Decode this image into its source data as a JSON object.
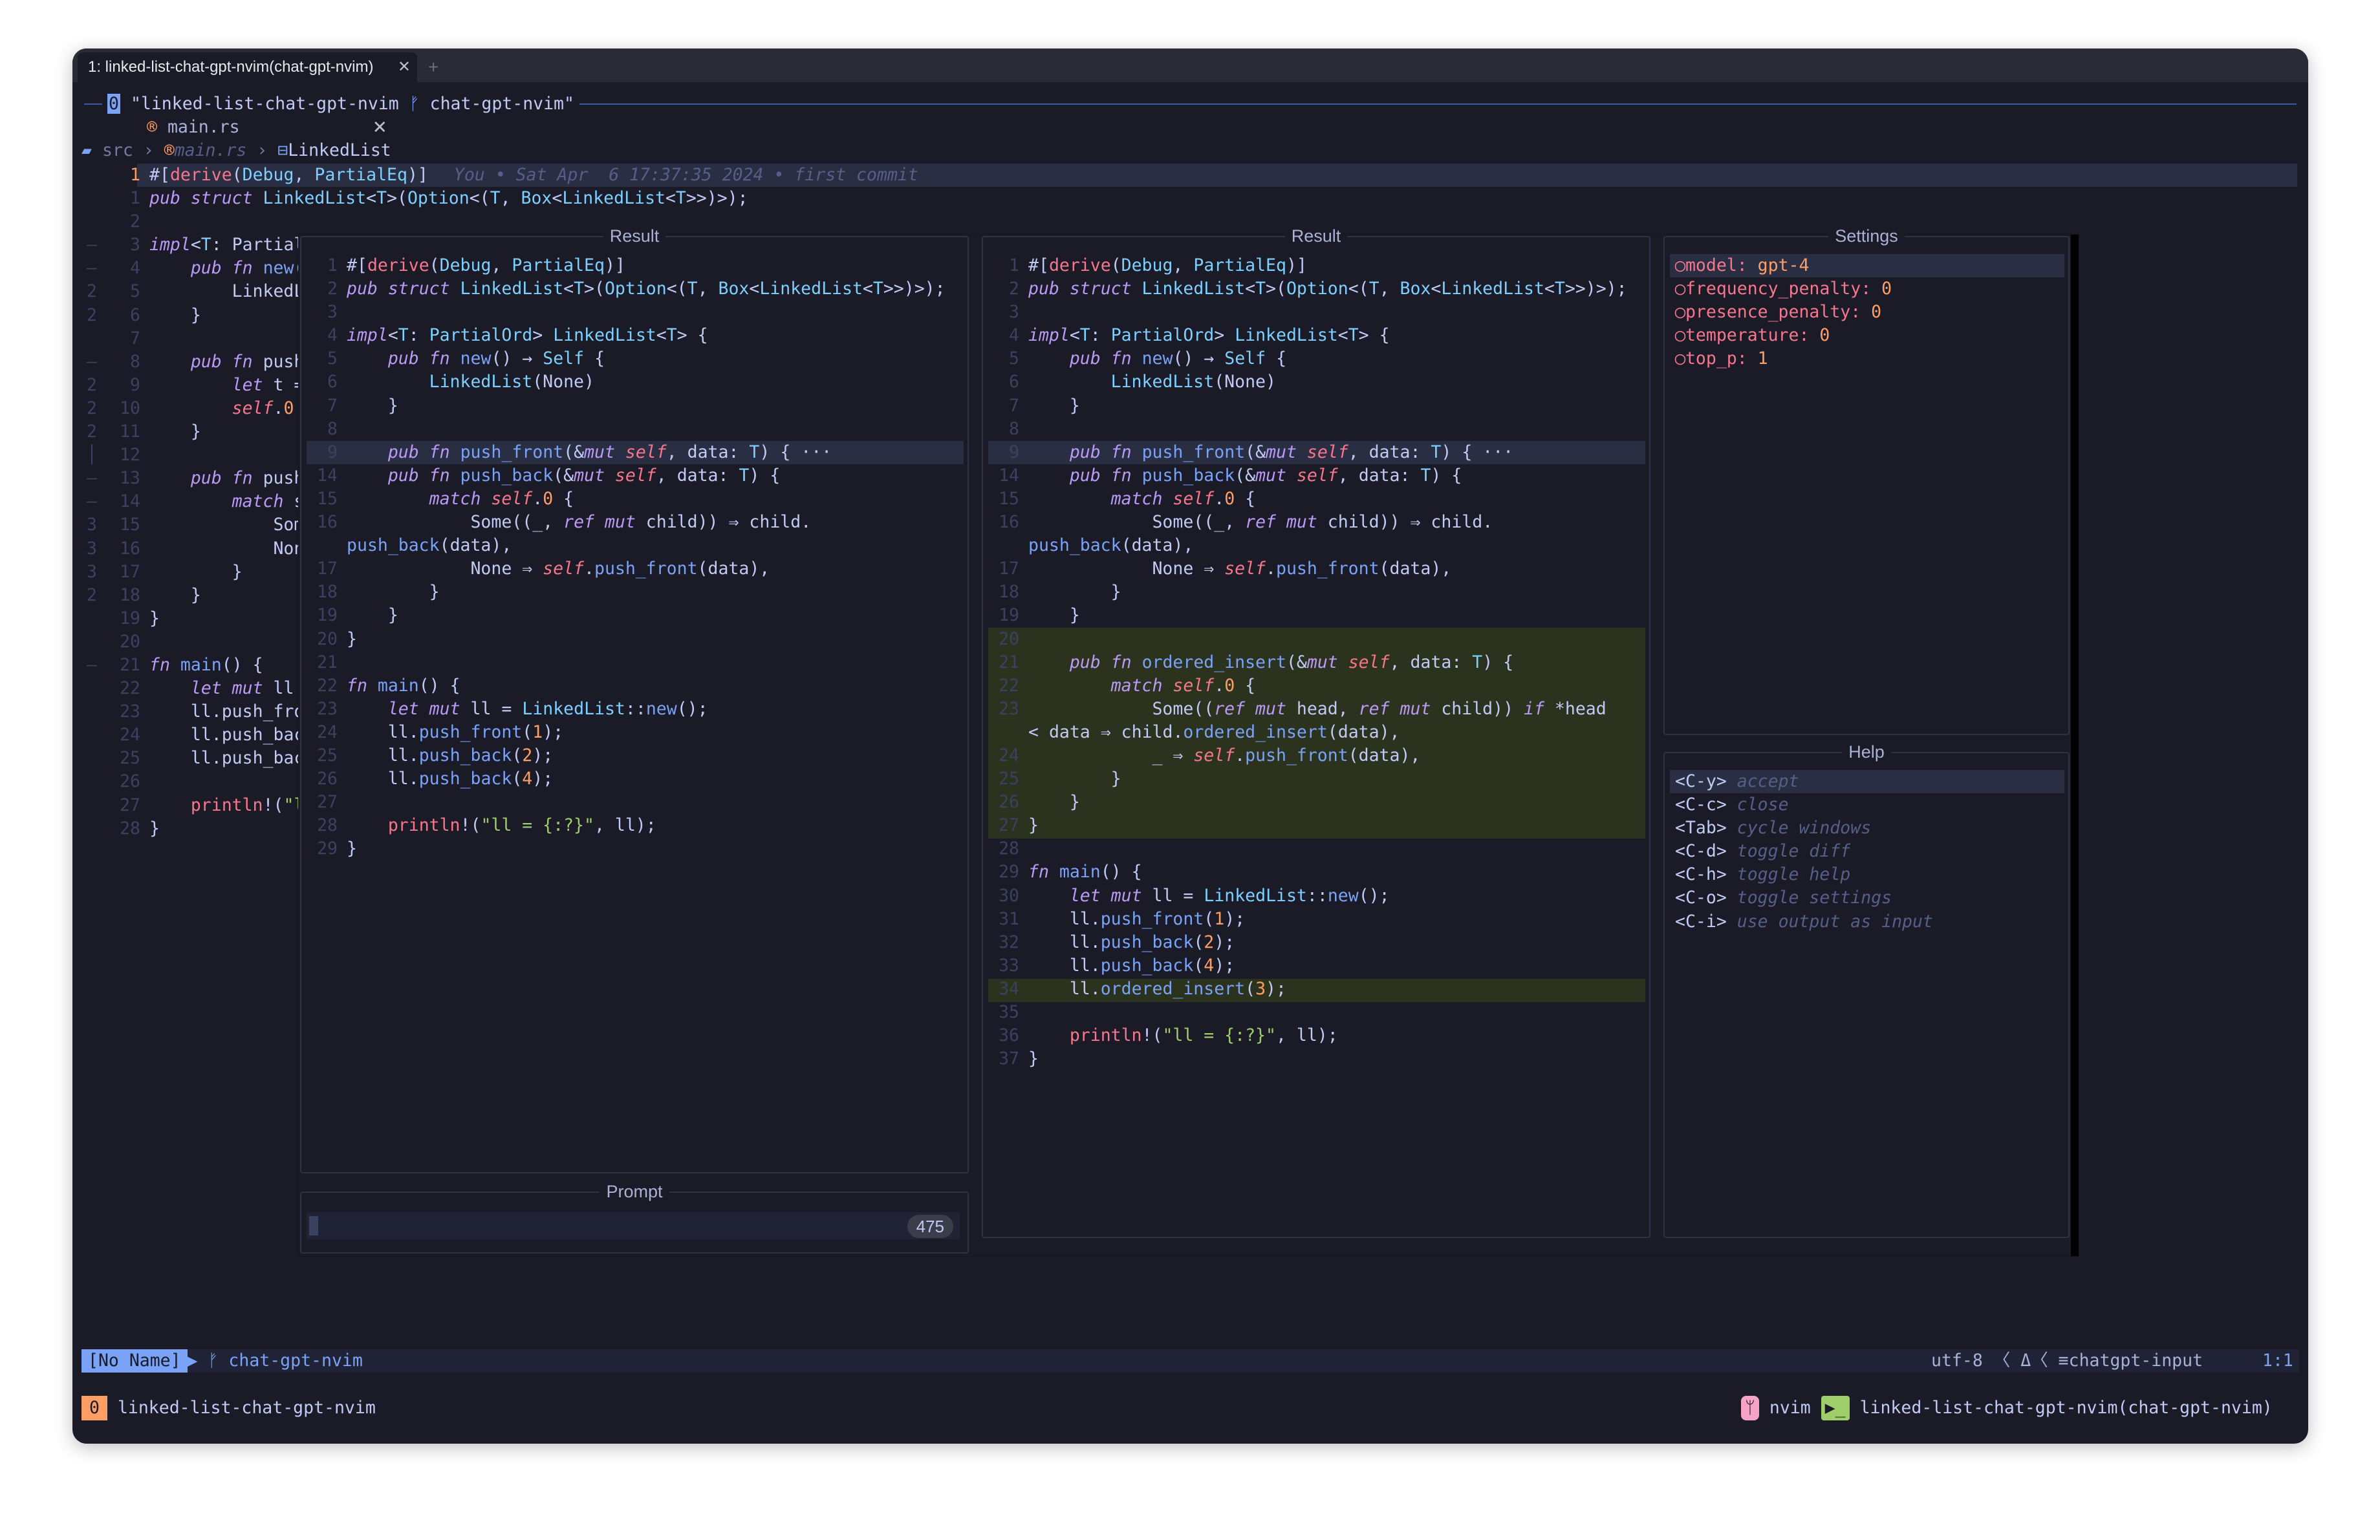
{
  "terminal": {
    "tab_label": "1: linked-list-chat-gpt-nvim(chat-gpt-nvim)",
    "tab_close": "✕",
    "new_tab": "+"
  },
  "tmux": {
    "window_num": "0",
    "session": "\"linked-list-chat-gpt-nvim",
    "branch_icon": "ᚠ",
    "branch": "chat-gpt-nvim\""
  },
  "editor": {
    "filename": "main.rs",
    "breadcrumb": [
      "src",
      "main.rs",
      "LinkedList"
    ],
    "blame": "You • Sat Apr  6 17:37:35 2024 • first commit",
    "lines": [
      {
        "g": "",
        "n": "1",
        "t": "#[derive(Debug, PartialEq)]"
      },
      {
        "g": "",
        "n": "1",
        "t": "pub struct LinkedList<T>(Option<(T, Box<LinkedList<T>>)>);"
      },
      {
        "g": "",
        "n": "2",
        "t": ""
      },
      {
        "g": "–",
        "n": "3",
        "t": "impl<T: Partial"
      },
      {
        "g": "–",
        "n": "4",
        "t": "    pub fn new("
      },
      {
        "g": "2",
        "n": "5",
        "t": "        LinkedL"
      },
      {
        "g": "2",
        "n": "6",
        "t": "    }"
      },
      {
        "g": "",
        "n": "7",
        "t": ""
      },
      {
        "g": "–",
        "n": "8",
        "t": "    pub fn push"
      },
      {
        "g": "2",
        "n": "9",
        "t": "        let t ="
      },
      {
        "g": "2",
        "n": "10",
        "t": "        self.0"
      },
      {
        "g": "2",
        "n": "11",
        "t": "    }"
      },
      {
        "g": "│",
        "n": "12",
        "t": ""
      },
      {
        "g": "–",
        "n": "13",
        "t": "    pub fn push"
      },
      {
        "g": "–",
        "n": "14",
        "t": "        match s"
      },
      {
        "g": "3",
        "n": "15",
        "t": "            Som"
      },
      {
        "g": "3",
        "n": "16",
        "t": "            Non"
      },
      {
        "g": "3",
        "n": "17",
        "t": "        }"
      },
      {
        "g": "2",
        "n": "18",
        "t": "    }"
      },
      {
        "g": "",
        "n": "19",
        "t": "}"
      },
      {
        "g": "",
        "n": "20",
        "t": ""
      },
      {
        "g": "–",
        "n": "21",
        "t": "fn main() {"
      },
      {
        "g": "",
        "n": "22",
        "t": "    let mut ll"
      },
      {
        "g": "",
        "n": "23",
        "t": "    ll.push_fro"
      },
      {
        "g": "",
        "n": "24",
        "t": "    ll.push_bac"
      },
      {
        "g": "",
        "n": "25",
        "t": "    ll.push_bac"
      },
      {
        "g": "",
        "n": "26",
        "t": ""
      },
      {
        "g": "",
        "n": "27",
        "t": "    println!(\"l"
      },
      {
        "g": "",
        "n": "28",
        "t": "}"
      }
    ]
  },
  "result_left": {
    "title": "Result",
    "lines": [
      {
        "n": "1",
        "t": "#[derive(Debug, PartialEq)]"
      },
      {
        "n": "2",
        "t": "pub struct LinkedList<T>(Option<(T, Box<LinkedList<T>>)>);"
      },
      {
        "n": "3",
        "t": ""
      },
      {
        "n": "4",
        "t": "impl<T: PartialOrd> LinkedList<T> {"
      },
      {
        "n": "5",
        "t": "    pub fn new() → Self {"
      },
      {
        "n": "6",
        "t": "        LinkedList(None)"
      },
      {
        "n": "7",
        "t": "    }"
      },
      {
        "n": "8",
        "t": ""
      },
      {
        "n": "9",
        "t": "    pub fn push_front(&mut self, data: T) { ···"
      },
      {
        "n": "14",
        "t": "    pub fn push_back(&mut self, data: T) {"
      },
      {
        "n": "15",
        "t": "        match self.0 {"
      },
      {
        "n": "16",
        "t": "            Some((_, ref mut child)) ⇒ child."
      },
      {
        "n": "",
        "t": "push_back(data),"
      },
      {
        "n": "17",
        "t": "            None ⇒ self.push_front(data),"
      },
      {
        "n": "18",
        "t": "        }"
      },
      {
        "n": "19",
        "t": "    }"
      },
      {
        "n": "20",
        "t": "}"
      },
      {
        "n": "21",
        "t": ""
      },
      {
        "n": "22",
        "t": "fn main() {"
      },
      {
        "n": "23",
        "t": "    let mut ll = LinkedList::new();"
      },
      {
        "n": "24",
        "t": "    ll.push_front(1);"
      },
      {
        "n": "25",
        "t": "    ll.push_back(2);"
      },
      {
        "n": "26",
        "t": "    ll.push_back(4);"
      },
      {
        "n": "27",
        "t": ""
      },
      {
        "n": "28",
        "t": "    println!(\"ll = {:?}\", ll);"
      },
      {
        "n": "29",
        "t": "}"
      }
    ]
  },
  "result_right": {
    "title": "Result",
    "lines": [
      {
        "n": "1",
        "t": "#[derive(Debug, PartialEq)]"
      },
      {
        "n": "2",
        "t": "pub struct LinkedList<T>(Option<(T, Box<LinkedList<T>>)>);"
      },
      {
        "n": "3",
        "t": ""
      },
      {
        "n": "4",
        "t": "impl<T: PartialOrd> LinkedList<T> {"
      },
      {
        "n": "5",
        "t": "    pub fn new() → Self {"
      },
      {
        "n": "6",
        "t": "        LinkedList(None)"
      },
      {
        "n": "7",
        "t": "    }"
      },
      {
        "n": "8",
        "t": ""
      },
      {
        "n": "9",
        "t": "    pub fn push_front(&mut self, data: T) { ···"
      },
      {
        "n": "14",
        "t": "    pub fn push_back(&mut self, data: T) {"
      },
      {
        "n": "15",
        "t": "        match self.0 {"
      },
      {
        "n": "16",
        "t": "            Some((_, ref mut child)) ⇒ child."
      },
      {
        "n": "",
        "t": "push_back(data),"
      },
      {
        "n": "17",
        "t": "            None ⇒ self.push_front(data),"
      },
      {
        "n": "18",
        "t": "        }"
      },
      {
        "n": "19",
        "t": "    }"
      },
      {
        "n": "20",
        "t": ""
      },
      {
        "n": "21",
        "t": "    pub fn ordered_insert(&mut self, data: T) {"
      },
      {
        "n": "22",
        "t": "        match self.0 {"
      },
      {
        "n": "23",
        "t": "            Some((ref mut head, ref mut child)) if *head"
      },
      {
        "n": "",
        "t": "< data ⇒ child.ordered_insert(data),"
      },
      {
        "n": "24",
        "t": "            _ ⇒ self.push_front(data),"
      },
      {
        "n": "25",
        "t": "        }"
      },
      {
        "n": "26",
        "t": "    }"
      },
      {
        "n": "27",
        "t": "}"
      },
      {
        "n": "28",
        "t": ""
      },
      {
        "n": "29",
        "t": "fn main() {"
      },
      {
        "n": "30",
        "t": "    let mut ll = LinkedList::new();"
      },
      {
        "n": "31",
        "t": "    ll.push_front(1);"
      },
      {
        "n": "32",
        "t": "    ll.push_back(2);"
      },
      {
        "n": "33",
        "t": "    ll.push_back(4);"
      },
      {
        "n": "34",
        "t": "    ll.ordered_insert(3);"
      },
      {
        "n": "35",
        "t": ""
      },
      {
        "n": "36",
        "t": "    println!(\"ll = {:?}\", ll);"
      },
      {
        "n": "37",
        "t": "}"
      }
    ]
  },
  "settings": {
    "title": "Settings",
    "items": [
      {
        "key": "model:",
        "value": "gpt-4"
      },
      {
        "key": "frequency_penalty:",
        "value": "0"
      },
      {
        "key": "presence_penalty:",
        "value": "0"
      },
      {
        "key": "temperature:",
        "value": "0"
      },
      {
        "key": "top_p:",
        "value": "1"
      }
    ]
  },
  "help": {
    "title": "Help",
    "items": [
      {
        "key": "<C-y>",
        "desc": "accept"
      },
      {
        "key": "<C-c>",
        "desc": "close"
      },
      {
        "key": "<Tab>",
        "desc": "cycle windows"
      },
      {
        "key": "<C-d>",
        "desc": "toggle diff"
      },
      {
        "key": "<C-h>",
        "desc": "toggle help"
      },
      {
        "key": "<C-o>",
        "desc": "toggle settings"
      },
      {
        "key": "<C-i>",
        "desc": "use output as input"
      }
    ]
  },
  "prompt": {
    "title": "Prompt",
    "count": "475"
  },
  "statusline": {
    "mode": "[No Name]",
    "branch": "chat-gpt-nvim",
    "encoding": "utf-8",
    "filetype": "chatgpt-input",
    "position": "1:1"
  },
  "tmux_status": {
    "window": "0",
    "session": "linked-list-chat-gpt-nvim",
    "app": "nvim",
    "pane_title": "linked-list-chat-gpt-nvim(chat-gpt-nvim)"
  },
  "colors": {
    "bg": "#1a1b26",
    "blue": "#7aa2f7",
    "purple": "#bb9af7",
    "red": "#f7768e",
    "orange": "#ff9e64",
    "green": "#9ece6a",
    "diff_add_bg": "#2b331f"
  }
}
